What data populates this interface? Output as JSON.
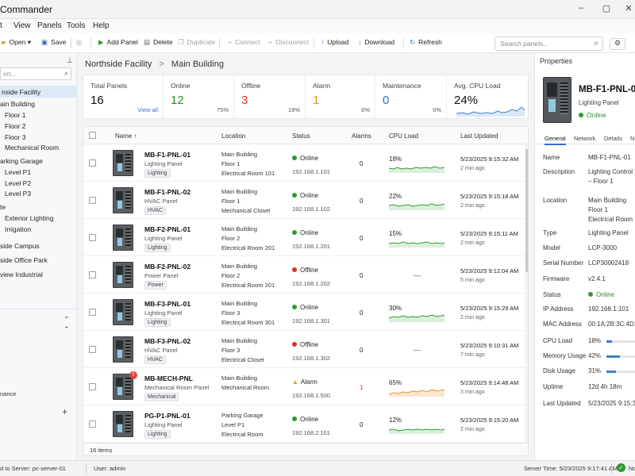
{
  "app": {
    "title": "Commander"
  },
  "menu": [
    "t",
    "View",
    "Panels",
    "Tools",
    "Help"
  ],
  "toolbar": {
    "open": "Open",
    "save": "Save",
    "add_panel": "Add Panel",
    "delete": "Delete",
    "duplicate": "Duplicate",
    "connect": "Connect",
    "disconnect": "Disconnect",
    "upload": "Upload",
    "download": "Download",
    "refresh": "Refresh",
    "search_placeholder": "Search panels..."
  },
  "sidebar": {
    "search_placeholder": "ets...",
    "items": [
      {
        "label": "nside Facility",
        "indent": 0,
        "selected": true
      },
      {
        "label": "ain Building",
        "indent": 0
      },
      {
        "label": "Floor 1",
        "indent": 1
      },
      {
        "label": "Floor 2",
        "indent": 1
      },
      {
        "label": "Floor 3",
        "indent": 1
      },
      {
        "label": "Mechanical Room",
        "indent": 1
      },
      {
        "label": "arking Garage",
        "indent": 0
      },
      {
        "label": "Level P1",
        "indent": 1
      },
      {
        "label": "Level P2",
        "indent": 1
      },
      {
        "label": "Level P3",
        "indent": 1
      },
      {
        "label": "te",
        "indent": 0
      },
      {
        "label": "Exterior Lighting",
        "indent": 1
      },
      {
        "label": "Irrigation",
        "indent": 1
      },
      {
        "label": "side Campus",
        "indent": 0,
        "group": true
      },
      {
        "label": "side Office Park",
        "indent": 0,
        "group": true
      },
      {
        "label": "view Industrial",
        "indent": 0,
        "group": true
      }
    ],
    "bottom_item": "nance"
  },
  "breadcrumb": {
    "first": "Northside Facility",
    "sep": ">",
    "second": "Main Building"
  },
  "stats": [
    {
      "label": "Total Panels",
      "value": "16",
      "link": "View all",
      "color": "#111111"
    },
    {
      "label": "Online",
      "value": "12",
      "pct": "75%",
      "color": "#2f8a2f"
    },
    {
      "label": "Offline",
      "value": "3",
      "pct": "19%",
      "color": "#d33a2c"
    },
    {
      "label": "Alarm",
      "value": "1",
      "pct": "6%",
      "color": "#e0902b"
    },
    {
      "label": "Maintenance",
      "value": "0",
      "pct": "0%",
      "color": "#2a6fd6"
    },
    {
      "label": "Avg. CPU Load",
      "value": "24%",
      "color": "#111111"
    }
  ],
  "grid": {
    "headers": {
      "name": "Name ↑",
      "location": "Location",
      "status": "Status",
      "alarms": "Alarms",
      "cpu": "CPU Load",
      "updated": "Last Updated"
    },
    "footer": "16 items",
    "rows": [
      {
        "name": "MB-F1-PNL-01",
        "desc": "Lighting Panel",
        "tag": "Lighting",
        "loc1": "Main Building",
        "loc2": "Floor 1",
        "loc3": "Electrical Room 101",
        "status": "Online",
        "ip": "192.168.1.101",
        "alarms": "0",
        "cpu": "18%",
        "updated": "5/23/2025 9:15:32 AM",
        "ago": "2 min ago"
      },
      {
        "name": "MB-F1-PNL-02",
        "desc": "HVAC Panel",
        "tag": "HVAC",
        "loc1": "Main Building",
        "loc2": "Floor 1",
        "loc3": "Mechanical Closet",
        "status": "Online",
        "ip": "192.168.1.102",
        "alarms": "0",
        "cpu": "22%",
        "updated": "5/23/2025 9:15:18 AM",
        "ago": "2 min ago"
      },
      {
        "name": "MB-F2-PNL-01",
        "desc": "Lighting Panel",
        "tag": "Lighting",
        "loc1": "Main Building",
        "loc2": "Floor 2",
        "loc3": "Electrical Room 201",
        "status": "Online",
        "ip": "192.168.1.201",
        "alarms": "0",
        "cpu": "15%",
        "updated": "5/23/2025 9:15:11 AM",
        "ago": "2 min ago"
      },
      {
        "name": "MB-F2-PNL-02",
        "desc": "Power Panel",
        "tag": "Power",
        "loc1": "Main Building",
        "loc2": "Floor 2",
        "loc3": "Electrical Room 201",
        "status": "Offline",
        "ip": "192.168.1.202",
        "alarms": "0",
        "cpu": "—",
        "updated": "5/23/2025 9:12:04 AM",
        "ago": "5 min ago"
      },
      {
        "name": "MB-F3-PNL-01",
        "desc": "Lighting Panel",
        "tag": "Lighting",
        "loc1": "Main Building",
        "loc2": "Floor 3",
        "loc3": "Electrical Room 301",
        "status": "Online",
        "ip": "192.168.1.301",
        "alarms": "0",
        "cpu": "30%",
        "updated": "5/23/2025 9:15:29 AM",
        "ago": "2 min ago"
      },
      {
        "name": "MB-F3-PNL-02",
        "desc": "HVAC Panel",
        "tag": "HVAC",
        "loc1": "Main Building",
        "loc2": "Floor 3",
        "loc3": "Electrical Closet",
        "status": "Offline",
        "ip": "192.168.1.302",
        "alarms": "0",
        "cpu": "—",
        "updated": "5/23/2025 9:10:31 AM",
        "ago": "7 min ago"
      },
      {
        "name": "MB-MECH-PNL",
        "desc": "Mechanical Room Panel",
        "tag": "Mechanical",
        "loc1": "Main Building",
        "loc2": "Mechanical Room",
        "loc3": "",
        "status": "Alarm",
        "ip": "192.168.1.500",
        "alarms": "1",
        "cpu": "65%",
        "updated": "5/23/2025 9:14:48 AM",
        "ago": "3 min ago"
      },
      {
        "name": "PG-P1-PNL-01",
        "desc": "Lighting Panel",
        "tag": "Lighting",
        "loc1": "Parking Garage",
        "loc2": "Level P1",
        "loc3": "Electrical Room",
        "status": "Online",
        "ip": "192.168.2.101",
        "alarms": "0",
        "cpu": "12%",
        "updated": "5/23/2025 9:15:20 AM",
        "ago": "2 min ago"
      }
    ]
  },
  "status_colors": {
    "Online": "#2f9a2f",
    "Offline": "#d9342b",
    "Alarm": "#e8962a"
  },
  "properties": {
    "header": "Properties",
    "title": "MB-F1-PNL-01",
    "subtitle": "Lighting Panel",
    "status": "Online",
    "tabs": [
      "General",
      "Network",
      "Details",
      "N"
    ],
    "fields": [
      {
        "k": "Name",
        "v": "MB-F1-PNL-01"
      },
      {
        "k": "Description",
        "v": "Lighting Control Pa",
        "v2": "– Floor 1"
      },
      {
        "k": "Location",
        "v": "Main Building",
        "v2": "Floor 1",
        "v3": "Electrical Room 101"
      },
      {
        "k": "Type",
        "v": "Lighting Panel"
      },
      {
        "k": "Model",
        "v": "LCP-3000"
      },
      {
        "k": "Serial Number",
        "v": "LCP30002418"
      },
      {
        "k": "Firmware",
        "v": "v2.4.1"
      },
      {
        "k": "Status",
        "v": "Online"
      },
      {
        "k": "IP Address",
        "v": "192.168.1.101"
      },
      {
        "k": "MAC Address",
        "v": "00:1A:2B:3C:4D:5"
      },
      {
        "k": "CPU Load",
        "v": "18%",
        "bar": 0.18
      },
      {
        "k": "Memory Usage",
        "v": "42%",
        "bar": 0.42
      },
      {
        "k": "Disk Usage",
        "v": "31%",
        "bar": 0.31
      },
      {
        "k": "Uptime",
        "v": "12d 4h 18m"
      },
      {
        "k": "Last Updated",
        "v": "5/23/2025 9:15:32"
      }
    ]
  },
  "statusbar": {
    "server": "d to Server:  pc-server-01",
    "user": "User:  admin",
    "server_time": "Server Time: 5/23/2025 9:17:41 AM",
    "conn": "No"
  }
}
